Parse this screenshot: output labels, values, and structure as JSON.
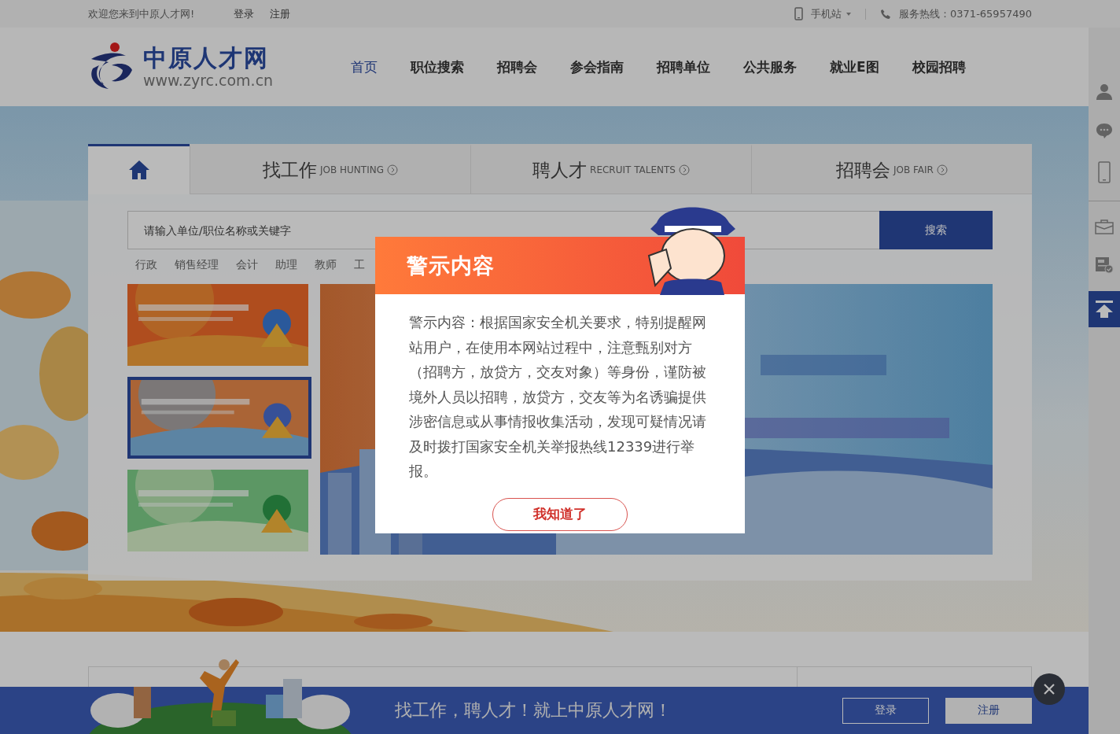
{
  "topbar": {
    "welcome": "欢迎您来到中原人才网!",
    "links": [
      "登录",
      "注册"
    ],
    "mobile": "手机站",
    "hotline": "服务热线：0371-65957490"
  },
  "logo": {
    "name": "中原人才网",
    "url": "www.zyrc.com.cn"
  },
  "nav": [
    {
      "label": "首页",
      "selected": true
    },
    {
      "label": "职位搜索",
      "selected": false
    },
    {
      "label": "招聘会",
      "selected": false
    },
    {
      "label": "参会指南",
      "selected": false
    },
    {
      "label": "招聘单位",
      "selected": false
    },
    {
      "label": "公共服务",
      "selected": false
    },
    {
      "label": "就业E图",
      "selected": false
    },
    {
      "label": "校园招聘",
      "selected": false
    }
  ],
  "search_tabs": [
    {
      "kind": "home",
      "selected": true
    },
    {
      "kind": "text",
      "title": "找工作",
      "subtitle": "JOB HUNTING",
      "selected": false
    },
    {
      "kind": "text",
      "title": "聘人才",
      "subtitle": "RECRUIT TALENTS",
      "selected": false
    },
    {
      "kind": "text",
      "title": "招聘会",
      "subtitle": "JOB FAIR",
      "selected": false
    }
  ],
  "search": {
    "placeholder": "请输入单位/职位名称或关键字",
    "button": "搜索"
  },
  "hot_keywords": [
    "行政",
    "销售经理",
    "会计",
    "助理",
    "教师",
    "工"
  ],
  "banners": [
    {
      "kind": "picture",
      "selected": false
    },
    {
      "kind": "picture",
      "selected": true
    },
    {
      "kind": "picture",
      "selected": false
    }
  ],
  "modal": {
    "title": "警示内容",
    "message": "警示内容：根据国家安全机关要求，特别提醒网站用户，在使用本网站过程中，注意甄别对方（招聘方，放贷方，交友对象）等身份，谨防被境外人员以招聘，放贷方，交友等为名诱骗提供涉密信息或从事情报收集活动，发现可疑情况请及时拨打国家安全机关举报热线12339进行举报。",
    "button": "我知道了"
  },
  "bottom_bar": {
    "slogan": "找工作，聘人才！就上中原人才网！",
    "buttons": [
      {
        "label": "登录",
        "kind": "outline"
      },
      {
        "label": "注册",
        "kind": "filled"
      }
    ]
  }
}
